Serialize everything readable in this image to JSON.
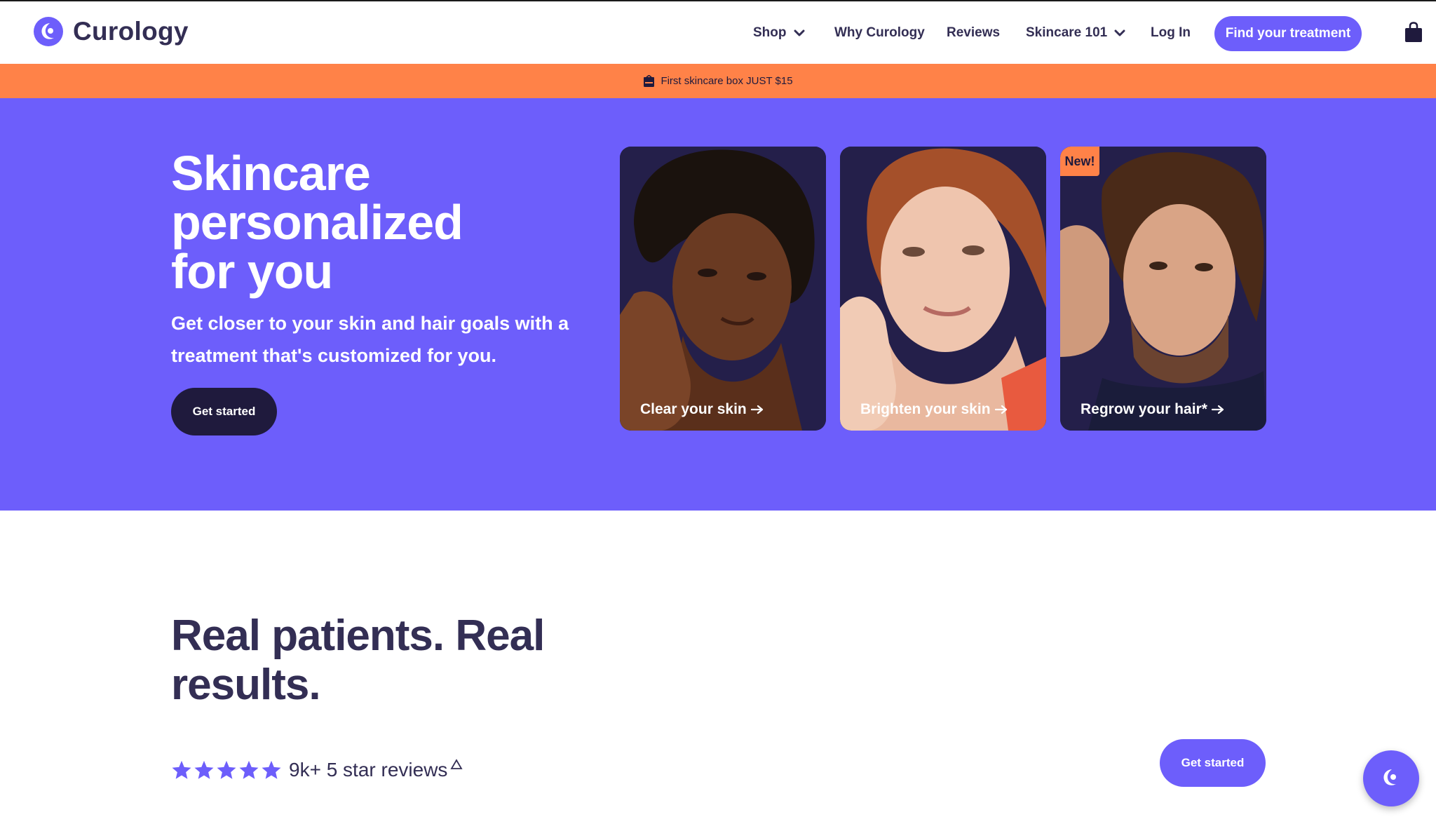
{
  "brand": {
    "name": "Curology",
    "logo_icon": "curology-logo-icon"
  },
  "nav": {
    "shop": "Shop",
    "why": "Why Curology",
    "reviews": "Reviews",
    "skincare101": "Skincare 101",
    "login": "Log In",
    "cta": "Find your treatment",
    "cart_icon": "shopping-bag-icon"
  },
  "promo": {
    "text": "First skincare box JUST $15",
    "icon": "gift-box-icon"
  },
  "hero": {
    "title": "Skincare personalized for you",
    "subtitle": "Get closer to your skin and hair goals with a treatment that's customized for you.",
    "button": "Get started",
    "cards": [
      {
        "label": "Clear your skin"
      },
      {
        "label": "Brighten your skin"
      },
      {
        "label": "Regrow your hair*",
        "badge": "New!"
      }
    ]
  },
  "results": {
    "title": "Real patients. Real results.",
    "rating_stars": 5,
    "rating_text": "9k+ 5 star reviews",
    "button": "Get started"
  },
  "colors": {
    "primary": "#6d5efb",
    "promo": "#ff8248",
    "dark": "#1f1a3d",
    "text": "#332e54"
  }
}
